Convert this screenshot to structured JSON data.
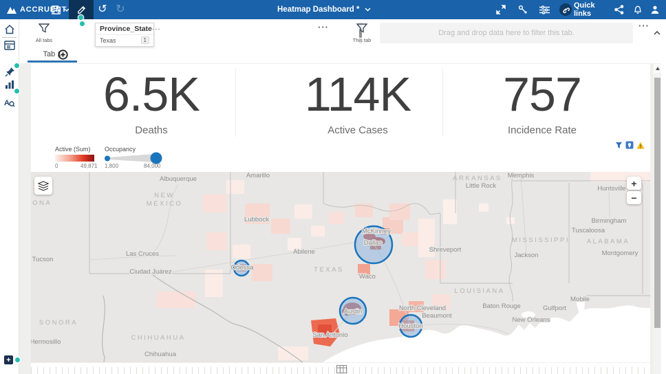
{
  "navbar": {
    "brand": "ACCRUENT",
    "title": "Heatmap Dashboard *",
    "quick_links": "Quick links"
  },
  "icons": {
    "undo": "↺",
    "redo": "↻",
    "dots": "···"
  },
  "filter_bar": {
    "all_tabs": "All tabs",
    "this_tab": "This tab",
    "chip": {
      "field": "Province_State",
      "value": "Texas",
      "count": "1"
    },
    "drop_zone": "Drag and drop data here to filter this tab."
  },
  "tabs": {
    "tab1": "Tab 1"
  },
  "kpis": [
    {
      "value": "6.5K",
      "label": "Deaths"
    },
    {
      "value": "114K",
      "label": "Active Cases"
    },
    {
      "value": "757",
      "label": "Incidence Rate"
    }
  ],
  "legend": {
    "color": {
      "title": "Active (Sum)",
      "min": "0",
      "max": "49,871"
    },
    "size": {
      "title": "Occupancy",
      "min": "1,800",
      "max": "84,000",
      "color": "#1c75bc"
    }
  },
  "map": {
    "controls": {
      "zoom_in": "+",
      "zoom_out": "−"
    },
    "bubbles": [
      {
        "city": "Dallas",
        "size": "large"
      },
      {
        "city": "Austin",
        "size": "medium"
      },
      {
        "city": "Houston",
        "size": "medium"
      },
      {
        "city": "Odessa",
        "size": "small"
      }
    ],
    "labels": [
      "Albuquerque",
      "Tucson",
      "Las Cruces",
      "Ciudad Juárez",
      "Amarillo",
      "Lubbock",
      "Abilene",
      "Waco",
      "McKinney",
      "Dallas",
      "Odessa",
      "Austin",
      "San Antonio",
      "North Cleveland",
      "Beaumont",
      "Houston",
      "Memphis",
      "Little Rock",
      "Huntsville",
      "Birmingham",
      "Tuscaloosa",
      "Jackson",
      "Montgomery",
      "Shreveport",
      "Baton Rouge",
      "Gulfport",
      "Mobile",
      "New Orleans",
      "Hermosillo",
      "Chihuahua",
      "ZONA",
      "NEW",
      "MEXICO",
      "TEXAS",
      "ARKANSAS",
      "MISSISSIPPI",
      "ALABAMA",
      "LOUISIANA",
      "SONORA",
      "CHIHUAHUA"
    ]
  },
  "colors": {
    "navbar_blue": "#1a62aa",
    "accent_teal": "#25beab",
    "bubble_stroke": "#1b74bc",
    "heat_max": "#8c1210"
  }
}
